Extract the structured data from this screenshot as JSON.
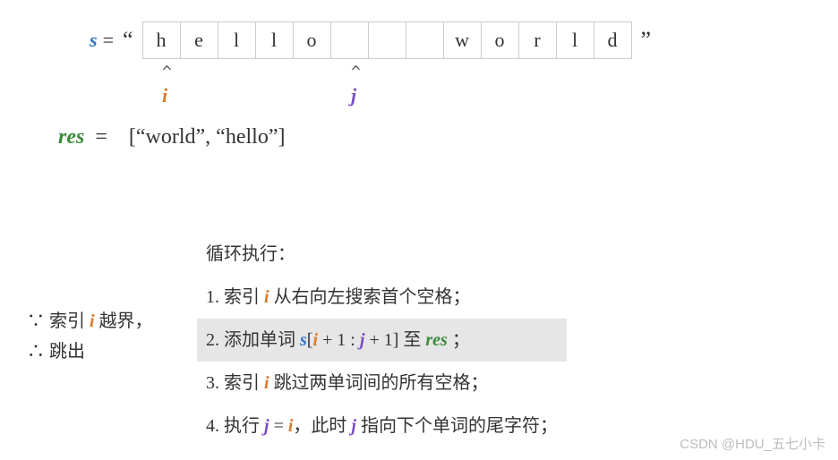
{
  "s_line": {
    "var": "s",
    "eq": "=",
    "open_quote": "“",
    "close_quote": "”",
    "cells": [
      "h",
      "e",
      "l",
      "l",
      "o",
      "",
      "",
      "",
      "w",
      "o",
      "r",
      "l",
      "d"
    ]
  },
  "pointers": {
    "caret": "^",
    "i_label": "i",
    "j_label": "j"
  },
  "res_line": {
    "var": "res",
    "eq": "=",
    "value": "[“world”, “hello”]"
  },
  "steps": {
    "header": "循环执行：",
    "s1_a": "1. 索引 ",
    "s1_i": "i",
    "s1_b": " 从右向左搜索首个空格；",
    "s2_a": "2. 添加单词 ",
    "s2_s": "s",
    "s2_b": "[",
    "s2_i": "i",
    "s2_c": " + 1 : ",
    "s2_j": "j",
    "s2_d": " + 1] 至 ",
    "s2_res": "res",
    "s2_e": " ；",
    "s3_a": "3. 索引 ",
    "s3_i": "i",
    "s3_b": " 跳过两单词间的所有空格；",
    "s4_a": "4. 执行 ",
    "s4_j": "j",
    "s4_b": " = ",
    "s4_i": "i",
    "s4_c": "，此时 ",
    "s4_j2": "j",
    "s4_d": " 指向下个单词的尾字符；"
  },
  "side": {
    "line1_a": "∵ 索引 ",
    "line1_i": "i",
    "line1_b": " 越界，",
    "line2": "∴ 跳出"
  },
  "watermark": "CSDN @HDU_五七小卡"
}
